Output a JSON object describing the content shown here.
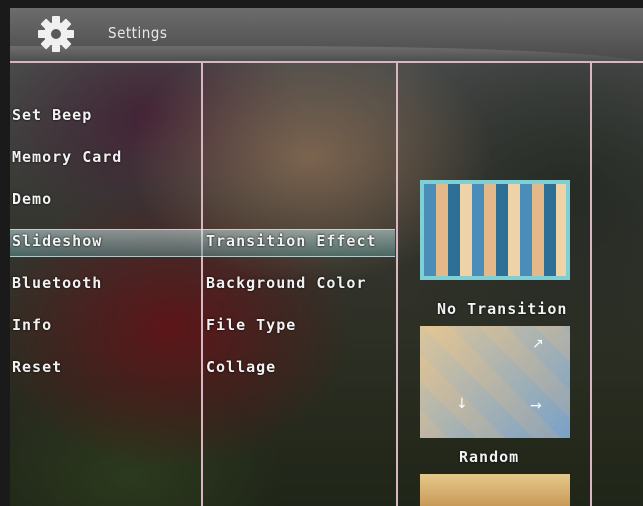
{
  "header": {
    "title": "Settings",
    "icon": "gear-icon"
  },
  "menu": {
    "items": [
      {
        "label": "Set Beep"
      },
      {
        "label": "Memory Card"
      },
      {
        "label": "Demo"
      },
      {
        "label": "Slideshow",
        "selected": true
      },
      {
        "label": "Bluetooth"
      },
      {
        "label": "Info"
      },
      {
        "label": "Reset"
      }
    ]
  },
  "submenu": {
    "items": [
      {
        "label": "Transition Effect",
        "selected": true
      },
      {
        "label": "Background Color"
      },
      {
        "label": "File Type"
      },
      {
        "label": "Collage"
      }
    ]
  },
  "options": [
    {
      "label": "No Transition",
      "selected": true
    },
    {
      "label": "Random"
    }
  ],
  "colors": {
    "accent_line": "#d9b7c2",
    "selection": "#7fd0d4",
    "text": "#f2f2f2"
  }
}
